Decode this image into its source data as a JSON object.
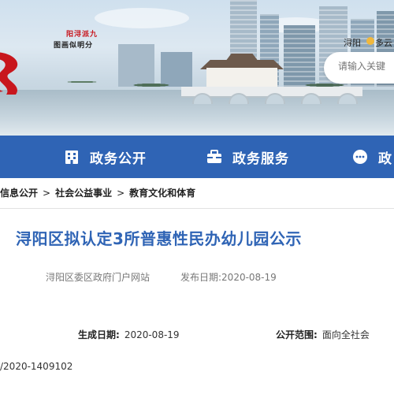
{
  "header": {
    "logo_text": [
      "九派浔阳",
      "分明似画图"
    ],
    "site_link": "浔阳",
    "site_link_2": "多云",
    "search": {
      "placeholder": "请输入关键"
    }
  },
  "nav": {
    "items": [
      {
        "label": "政务公开",
        "icon": "building-icon"
      },
      {
        "label": "政务服务",
        "icon": "briefcase-icon"
      },
      {
        "label": "政",
        "icon": "chat-icon"
      }
    ],
    "accent": "#2f64b5"
  },
  "breadcrumb": {
    "items": [
      "信息公开",
      "社会公益事业",
      "教育文化和体育"
    ],
    "separator": ">"
  },
  "article": {
    "title": "浔阳区拟认定3所普惠性民办幼儿园公示",
    "source": "浔阳区委区政府门户网站",
    "publish_label": "发布日期:",
    "publish_date": "2020-08-19",
    "generated_label": "生成日期:",
    "generated_date": "2020-08-19",
    "scope_label": "公开范围:",
    "scope_value": "面向全社会",
    "doc_number": "/2020-1409102"
  }
}
